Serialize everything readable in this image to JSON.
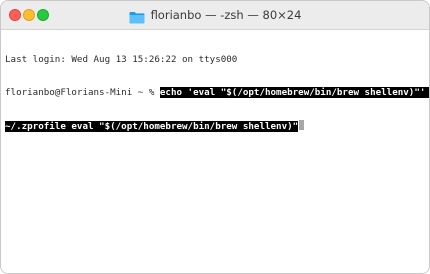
{
  "window": {
    "title": "florianbo — -zsh — 80×24",
    "icon": "folder-icon",
    "traffic_lights": {
      "close_color": "#ff5f57",
      "minimize_color": "#febc2e",
      "maximize_color": "#28c840"
    }
  },
  "terminal": {
    "last_login": "Last login: Wed Aug 13 15:26:22 on ttys000",
    "prompt": "florianbo@Florians-Mini ~ % ",
    "command_line1": "echo 'eval \"$(/opt/homebrew/bin/brew shellenv)\"' >>",
    "command_line2": "~/.zprofile eval \"$(/opt/homebrew/bin/brew shellenv)\""
  }
}
